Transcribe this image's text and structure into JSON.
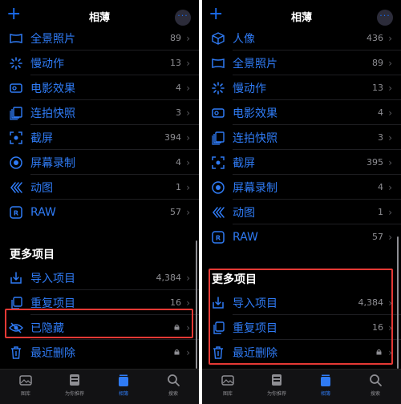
{
  "left": {
    "nav": {
      "title": "相薄",
      "plus": "+",
      "more": "···"
    },
    "rows": [
      {
        "icon": "panorama-icon",
        "label": "全景照片",
        "count": "89"
      },
      {
        "icon": "slow-motion-icon",
        "label": "慢动作",
        "count": "13"
      },
      {
        "icon": "cinematic-icon",
        "label": "电影效果",
        "count": "4"
      },
      {
        "icon": "burst-icon",
        "label": "连拍快照",
        "count": "3"
      },
      {
        "icon": "screenshot-icon",
        "label": "截屏",
        "count": "394"
      },
      {
        "icon": "screen-record-icon",
        "label": "屏幕录制",
        "count": "4"
      },
      {
        "icon": "animated-icon",
        "label": "动图",
        "count": "1"
      },
      {
        "icon": "raw-icon",
        "label": "RAW",
        "count": "57"
      }
    ],
    "section": "更多项目",
    "more_rows": [
      {
        "icon": "import-icon",
        "label": "导入项目",
        "count": "4,384"
      },
      {
        "icon": "duplicate-icon",
        "label": "重复项目",
        "count": "16"
      },
      {
        "icon": "hidden-icon",
        "label": "已隐藏",
        "count": ""
      },
      {
        "icon": "trash-icon",
        "label": "最近删除",
        "count": ""
      }
    ]
  },
  "right": {
    "nav": {
      "title": "相薄",
      "plus": "+",
      "more": "···"
    },
    "rows": [
      {
        "icon": "portrait-icon",
        "label": "人像",
        "count": "436"
      },
      {
        "icon": "panorama-icon",
        "label": "全景照片",
        "count": "89"
      },
      {
        "icon": "slow-motion-icon",
        "label": "慢动作",
        "count": "13"
      },
      {
        "icon": "cinematic-icon",
        "label": "电影效果",
        "count": "4"
      },
      {
        "icon": "burst-icon",
        "label": "连拍快照",
        "count": "3"
      },
      {
        "icon": "screenshot-icon",
        "label": "截屏",
        "count": "395"
      },
      {
        "icon": "screen-record-icon",
        "label": "屏幕录制",
        "count": "4"
      },
      {
        "icon": "animated-icon",
        "label": "动图",
        "count": "1"
      },
      {
        "icon": "raw-icon",
        "label": "RAW",
        "count": "57"
      }
    ],
    "section": "更多项目",
    "more_rows": [
      {
        "icon": "import-icon",
        "label": "导入项目",
        "count": "4,384"
      },
      {
        "icon": "duplicate-icon",
        "label": "重复项目",
        "count": "16"
      },
      {
        "icon": "trash-icon",
        "label": "最近删除",
        "count": ""
      }
    ]
  },
  "tabs": [
    {
      "icon": "library-icon",
      "label": "图库"
    },
    {
      "icon": "for-you-icon",
      "label": "为你推荐"
    },
    {
      "icon": "albums-icon",
      "label": "相簿"
    },
    {
      "icon": "search-icon",
      "label": "搜索"
    }
  ],
  "chevron": "›",
  "colors": {
    "accent": "#2f7bf5",
    "highlight": "#e53935",
    "background": "#000000"
  }
}
